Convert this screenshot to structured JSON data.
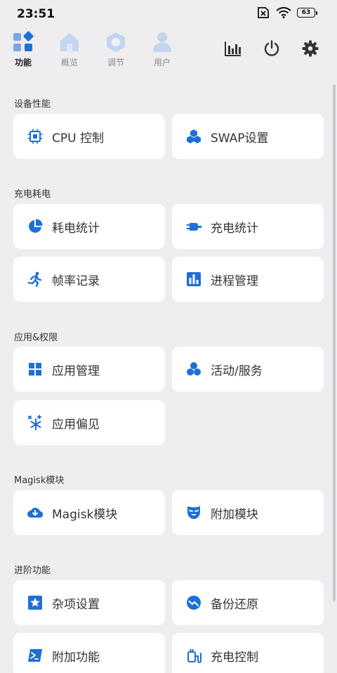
{
  "status_bar": {
    "time": "23:51",
    "battery": "63"
  },
  "tabs": [
    {
      "label": "功能",
      "icon": "grid-diamond-icon",
      "active": true
    },
    {
      "label": "概览",
      "icon": "home-icon",
      "active": false
    },
    {
      "label": "调节",
      "icon": "hexagon-icon",
      "active": false
    },
    {
      "label": "用户",
      "icon": "user-icon",
      "active": false
    }
  ],
  "actions": [
    {
      "icon": "bar-chart-icon"
    },
    {
      "icon": "power-icon"
    },
    {
      "icon": "gear-icon"
    }
  ],
  "sections": [
    {
      "title": "设备性能",
      "items": [
        {
          "label": "CPU 控制",
          "icon": "cpu-icon"
        },
        {
          "label": "SWAP设置",
          "icon": "cubes-icon"
        }
      ]
    },
    {
      "title": "充电耗电",
      "items": [
        {
          "label": "耗电统计",
          "icon": "pie-chart-icon"
        },
        {
          "label": "充电统计",
          "icon": "plug-icon"
        },
        {
          "label": "帧率记录",
          "icon": "running-icon"
        },
        {
          "label": "进程管理",
          "icon": "bar-graph-icon"
        }
      ]
    },
    {
      "title": "应用&权限",
      "items": [
        {
          "label": "应用管理",
          "icon": "apps-grid-icon"
        },
        {
          "label": "活动/服务",
          "icon": "circles-icon"
        },
        {
          "label": "应用偏见",
          "icon": "snowflake-icon"
        }
      ]
    },
    {
      "title": "Magisk模块",
      "items": [
        {
          "label": "Magisk模块",
          "icon": "cloud-download-icon"
        },
        {
          "label": "附加模块",
          "icon": "mask-icon"
        }
      ]
    },
    {
      "title": "进阶功能",
      "items": [
        {
          "label": "杂项设置",
          "icon": "star-icon"
        },
        {
          "label": "备份还原",
          "icon": "trend-icon"
        },
        {
          "label": "附加功能",
          "icon": "terminal-icon"
        },
        {
          "label": "充电控制",
          "icon": "charger-icon"
        }
      ]
    }
  ],
  "colors": {
    "accent": "#1e6fd6",
    "background": "#efedf0",
    "card": "#ffffff",
    "tab_inactive": "#b8cdea"
  }
}
